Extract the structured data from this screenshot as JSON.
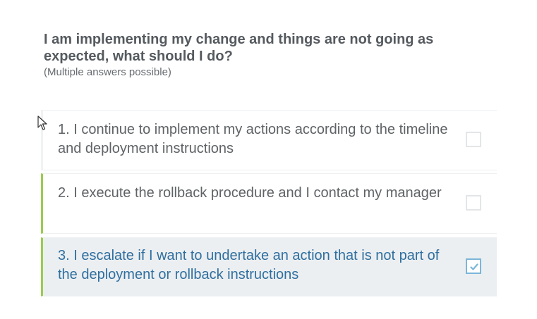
{
  "question": {
    "title": "I am implementing my change and things are not going as expected, what should I do?",
    "hint": "(Multiple answers possible)"
  },
  "options": [
    {
      "label": "1. I continue to implement my actions according to the timeline and deployment instructions",
      "checked": false
    },
    {
      "label": "2. I execute the rollback procedure and I contact my manager",
      "checked": false
    },
    {
      "label": "3. I escalate if I want to undertake an action that is not part of the deployment or rollback instructions",
      "checked": true
    }
  ],
  "colors": {
    "accent_bar": "#9ccc4f",
    "selected_text": "#2f6fa0",
    "selected_background": "#eceff1",
    "checkbox_checked": "#7bb6d9"
  },
  "icons": {
    "checkmark": "check-icon",
    "pointer": "cursor-icon"
  }
}
